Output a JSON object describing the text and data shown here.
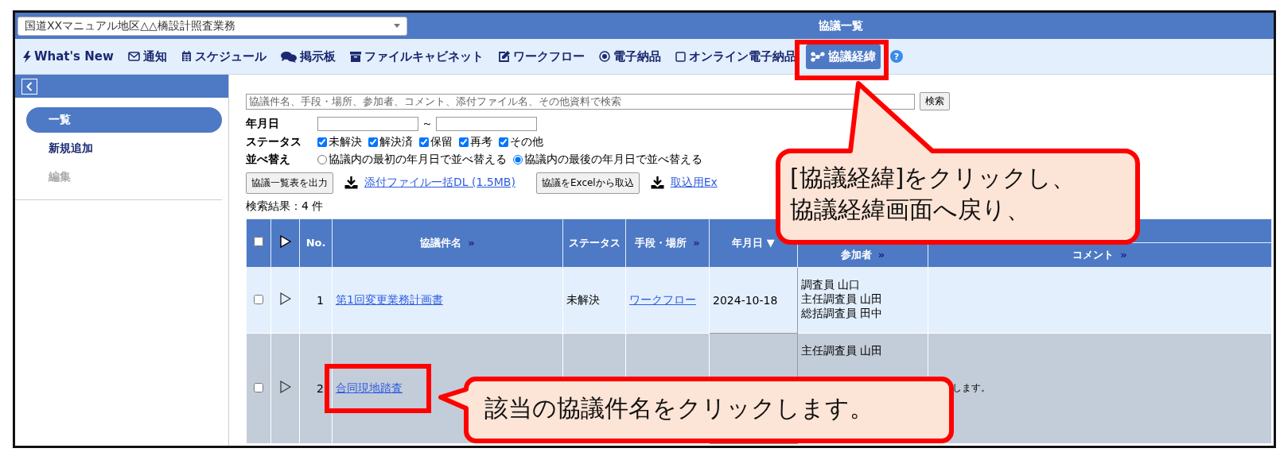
{
  "project_select": {
    "value": "国道XXマニュアル地区△△橋設計照査業務"
  },
  "title": "協議一覧",
  "nav": [
    {
      "label": "What's New",
      "selected": false
    },
    {
      "label": "通知",
      "selected": false
    },
    {
      "label": "スケジュール",
      "selected": false
    },
    {
      "label": "掲示板",
      "selected": false
    },
    {
      "label": "ファイルキャビネット",
      "selected": false
    },
    {
      "label": "ワークフロー",
      "selected": false
    },
    {
      "label": "電子納品",
      "selected": false
    },
    {
      "label": "オンライン電子納品",
      "selected": false
    },
    {
      "label": "協議経緯",
      "selected": true
    }
  ],
  "help": "?",
  "sidebar": {
    "items": [
      {
        "label": "一覧",
        "selected": true,
        "disabled": false
      },
      {
        "label": "新規追加",
        "selected": false,
        "disabled": false
      },
      {
        "label": "編集",
        "selected": false,
        "disabled": true
      }
    ]
  },
  "search": {
    "placeholder": "協議件名、手段・場所、参加者、コメント、添付ファイル名、その他資料で検索",
    "button": "検索"
  },
  "date_filter": {
    "label": "年月日",
    "separator": "～"
  },
  "status_filter": {
    "label": "ステータス",
    "options": [
      {
        "label": "未解決",
        "checked": true
      },
      {
        "label": "解決済",
        "checked": true
      },
      {
        "label": "保留",
        "checked": true
      },
      {
        "label": "再考",
        "checked": true
      },
      {
        "label": "その他",
        "checked": true
      }
    ]
  },
  "sort": {
    "label": "並べ替え",
    "options": [
      {
        "label": "協議内の最初の年月日で並べ替える",
        "selected": false
      },
      {
        "label": "協議内の最後の年月日で並べ替える",
        "selected": true
      }
    ]
  },
  "actions": [
    {
      "kind": "button",
      "label": "協議一覧表を出力"
    },
    {
      "kind": "download",
      "label": "添付ファイル一括DL (1.5MB)"
    },
    {
      "kind": "button",
      "label": "協議をExcelから取込"
    },
    {
      "kind": "download",
      "label": "取込用Ex"
    }
  ],
  "result_count": "検索結果：4 件",
  "table": {
    "header_checked": false,
    "columns": [
      {
        "label": "No."
      },
      {
        "label": "協議件名",
        "more": "»"
      },
      {
        "label": "ステータス"
      },
      {
        "label": "手段・場所",
        "more": "»"
      },
      {
        "label": "年月日 ▼"
      },
      {
        "label": "参加者",
        "more": "»"
      },
      {
        "label": "コメント",
        "more": "»"
      }
    ],
    "rows": [
      {
        "checked": false,
        "no": "1",
        "title": "第1回変更業務計画書",
        "status": "未解決",
        "method": "ワークフロー",
        "date": "2024-10-18",
        "participants": [
          "調査員 山口",
          "主任調査員 山田",
          "総括調査員 田中"
        ]
      },
      {
        "checked": false,
        "no": "2",
        "title": "合同現地踏査",
        "participants": [
          "主任調査員 山田"
        ],
        "comment": "します。"
      }
    ]
  },
  "annotations": [
    {
      "lines": [
        "[協議経緯]をクリックし、",
        "協議経緯画面へ戻り、"
      ]
    },
    {
      "lines": [
        "該当の協議件名をクリックします。"
      ]
    }
  ]
}
